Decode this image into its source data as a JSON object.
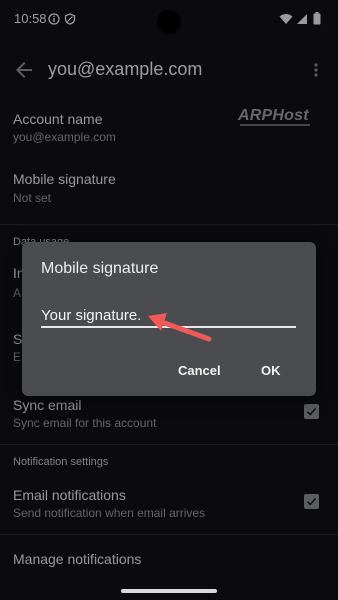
{
  "status_bar": {
    "time": "10:58",
    "icons": [
      "info-icon",
      "vpn-shield-icon",
      "wifi-icon",
      "signal-icon",
      "battery-icon"
    ]
  },
  "app_bar": {
    "title": "you@example.com",
    "back_icon": "back-arrow-icon",
    "menu_icon": "more-vert-icon"
  },
  "settings": {
    "account": {
      "title": "Account name",
      "value": "you@example.com"
    },
    "logo_text": "ARPHost",
    "mobile_signature": {
      "title": "Mobile signature",
      "value": "Not set"
    },
    "data_usage_header": "Data usage",
    "images_row": {
      "title_partial": "In",
      "sub_partial": "A"
    },
    "sync_partial": {
      "title_partial": "S",
      "sub_partial": "E"
    },
    "sync_email": {
      "title": "Sync email",
      "sub": "Sync email for this account",
      "checked": true
    },
    "notification_header": "Notification settings",
    "email_notifications": {
      "title": "Email notifications",
      "sub": "Send notification when email arrives",
      "checked": true
    },
    "manage_notifications": {
      "title": "Manage notifications"
    }
  },
  "dialog": {
    "title": "Mobile signature",
    "input_value": "Your signature.",
    "cancel_label": "Cancel",
    "ok_label": "OK"
  },
  "colors": {
    "background": "#111214",
    "dialog": "#4b4c4f",
    "arrow": "#f05a5a"
  }
}
